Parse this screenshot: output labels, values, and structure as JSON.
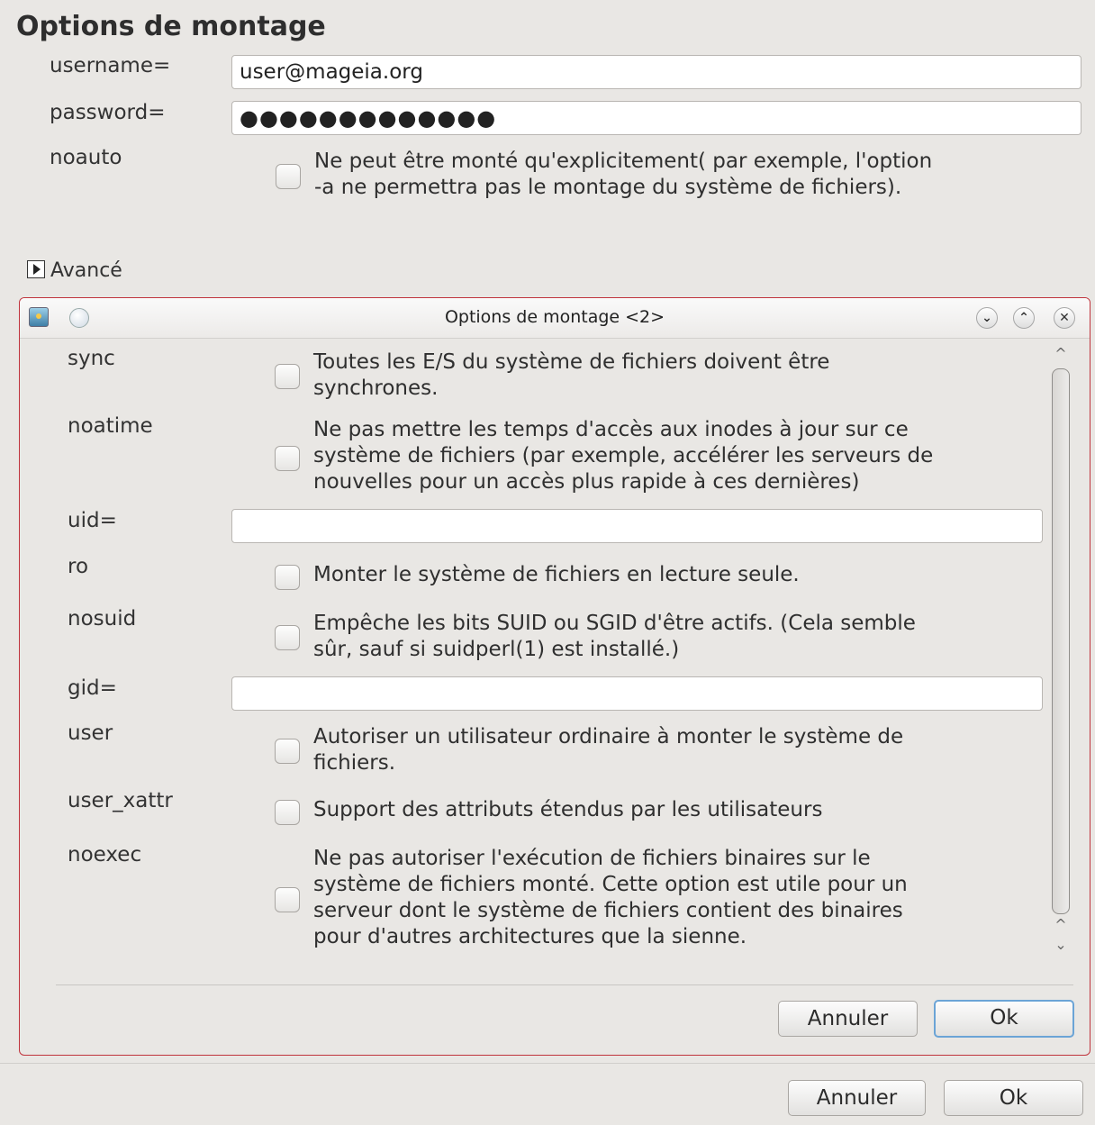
{
  "main": {
    "title": "Options de montage",
    "username_label": "username=",
    "username_value": "user@mageia.org",
    "password_label": "password=",
    "password_value": "●●●●●●●●●●●●●",
    "noauto_label": "noauto",
    "noauto_desc": "Ne peut être monté qu'explicitement( par exemple, l'option\n-a ne permettra pas le montage du système de fichiers).",
    "advanced_label": "Avancé"
  },
  "dialog": {
    "title": "Options de montage <2>",
    "options": [
      {
        "label": "sync",
        "desc": "Toutes les E/S du système de fichiers doivent être\nsynchrones."
      },
      {
        "label": "noatime",
        "desc": "Ne pas mettre les temps d'accès aux inodes à jour sur ce\nsystème de fichiers (par exemple, accélérer les serveurs de\nnouvelles pour un accès plus rapide à ces dernières)"
      },
      {
        "label": "uid=",
        "value": ""
      },
      {
        "label": "ro",
        "desc": "Monter le système de fichiers en lecture seule."
      },
      {
        "label": "nosuid",
        "desc": "Empêche les bits SUID ou SGID d'être actifs. (Cela semble\nsûr, sauf si suidperl(1) est installé.)"
      },
      {
        "label": "gid=",
        "value": ""
      },
      {
        "label": "user",
        "desc": "Autoriser un utilisateur ordinaire à monter le système de\nfichiers."
      },
      {
        "label": "user_xattr",
        "desc": "Support des attributs étendus par les utilisateurs"
      },
      {
        "label": "noexec",
        "desc": "Ne pas autoriser l'exécution de fichiers binaires sur le\nsystème de fichiers monté. Cette option est utile pour un\nserveur dont le système de fichiers contient des binaires\npour d'autres architectures que la sienne."
      }
    ],
    "cancel_label": "Annuler",
    "ok_label": "Ok"
  },
  "footer": {
    "cancel_label": "Annuler",
    "ok_label": "Ok"
  },
  "icons": {
    "minimize": "⌄",
    "maximize": "⌃",
    "close": "✕",
    "scroll_up": "^",
    "scroll_down_a": "^",
    "scroll_down_b": "⌄"
  }
}
